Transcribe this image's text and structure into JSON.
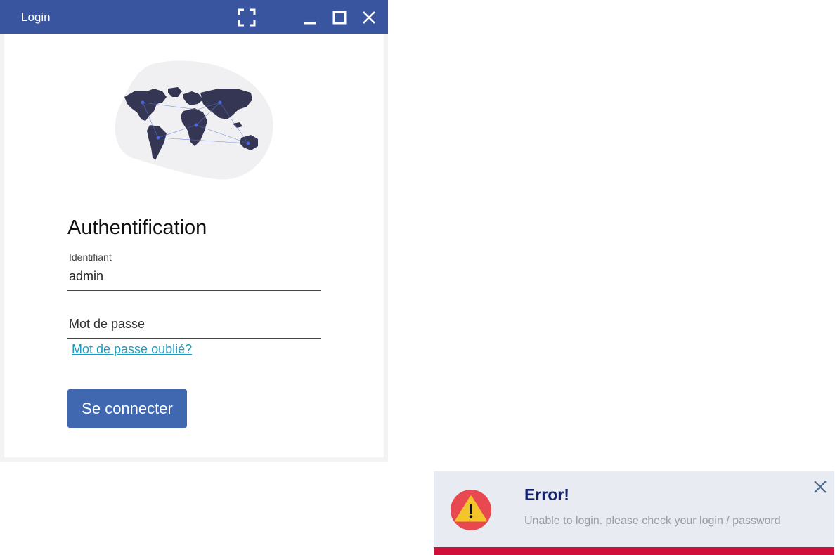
{
  "window": {
    "title": "Login",
    "controls": [
      "fullscreen-icon",
      "minimize-icon",
      "maximize-icon",
      "close-icon"
    ]
  },
  "form": {
    "heading": "Authentification",
    "username": {
      "label": "Identifiant",
      "value": "admin"
    },
    "password": {
      "placeholder": "Mot de passe"
    },
    "forgot_link": "Mot de passe oublié?",
    "submit_label": "Se connecter"
  },
  "toast": {
    "title": "Error!",
    "message": "Unable to login. please check your login / password",
    "icon": "warning-icon",
    "close_icon": "close-icon"
  },
  "colors": {
    "titlebar": "#3a55a0",
    "button": "#3f68b0",
    "link": "#1a9cc0",
    "toast_bg": "#e8ebf1",
    "toast_title": "#13206a",
    "toast_bar": "#d0103a"
  }
}
